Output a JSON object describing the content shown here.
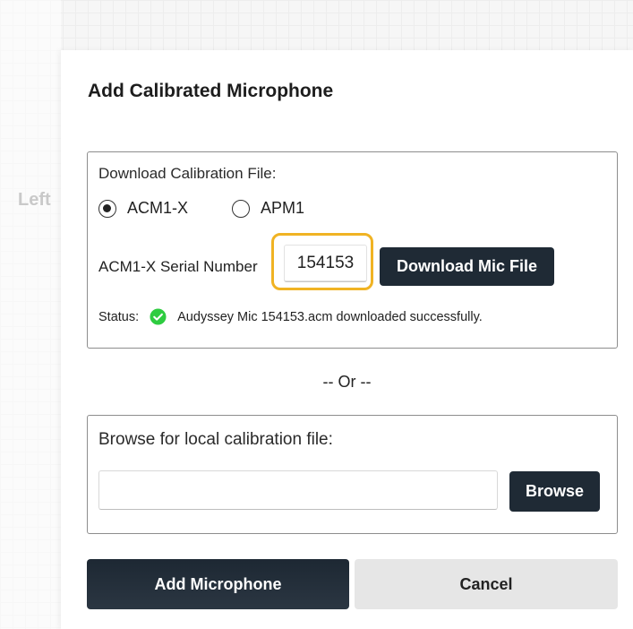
{
  "background": {
    "faded_label": "Left"
  },
  "dialog": {
    "title": "Add Calibrated Microphone",
    "download_section": {
      "heading": "Download Calibration File:",
      "radio_options": [
        {
          "label": "ACM1-X",
          "checked": true
        },
        {
          "label": "APM1",
          "checked": false
        }
      ],
      "serial_label": "ACM1-X Serial Number",
      "serial_value": "154153",
      "download_button": "Download Mic File",
      "status_label": "Status:",
      "status_icon": "check-circle-icon",
      "status_message": "Audyssey Mic 154153.acm downloaded successfully."
    },
    "or_divider": "-- Or --",
    "browse_section": {
      "heading": "Browse for local calibration file:",
      "path_value": "",
      "browse_button": "Browse"
    },
    "add_button": "Add Microphone",
    "cancel_button": "Cancel"
  },
  "colors": {
    "dark_button": "#1f2a35",
    "highlight": "#f0b323",
    "success": "#2ecc40",
    "cancel_button": "#e6e6e6"
  }
}
